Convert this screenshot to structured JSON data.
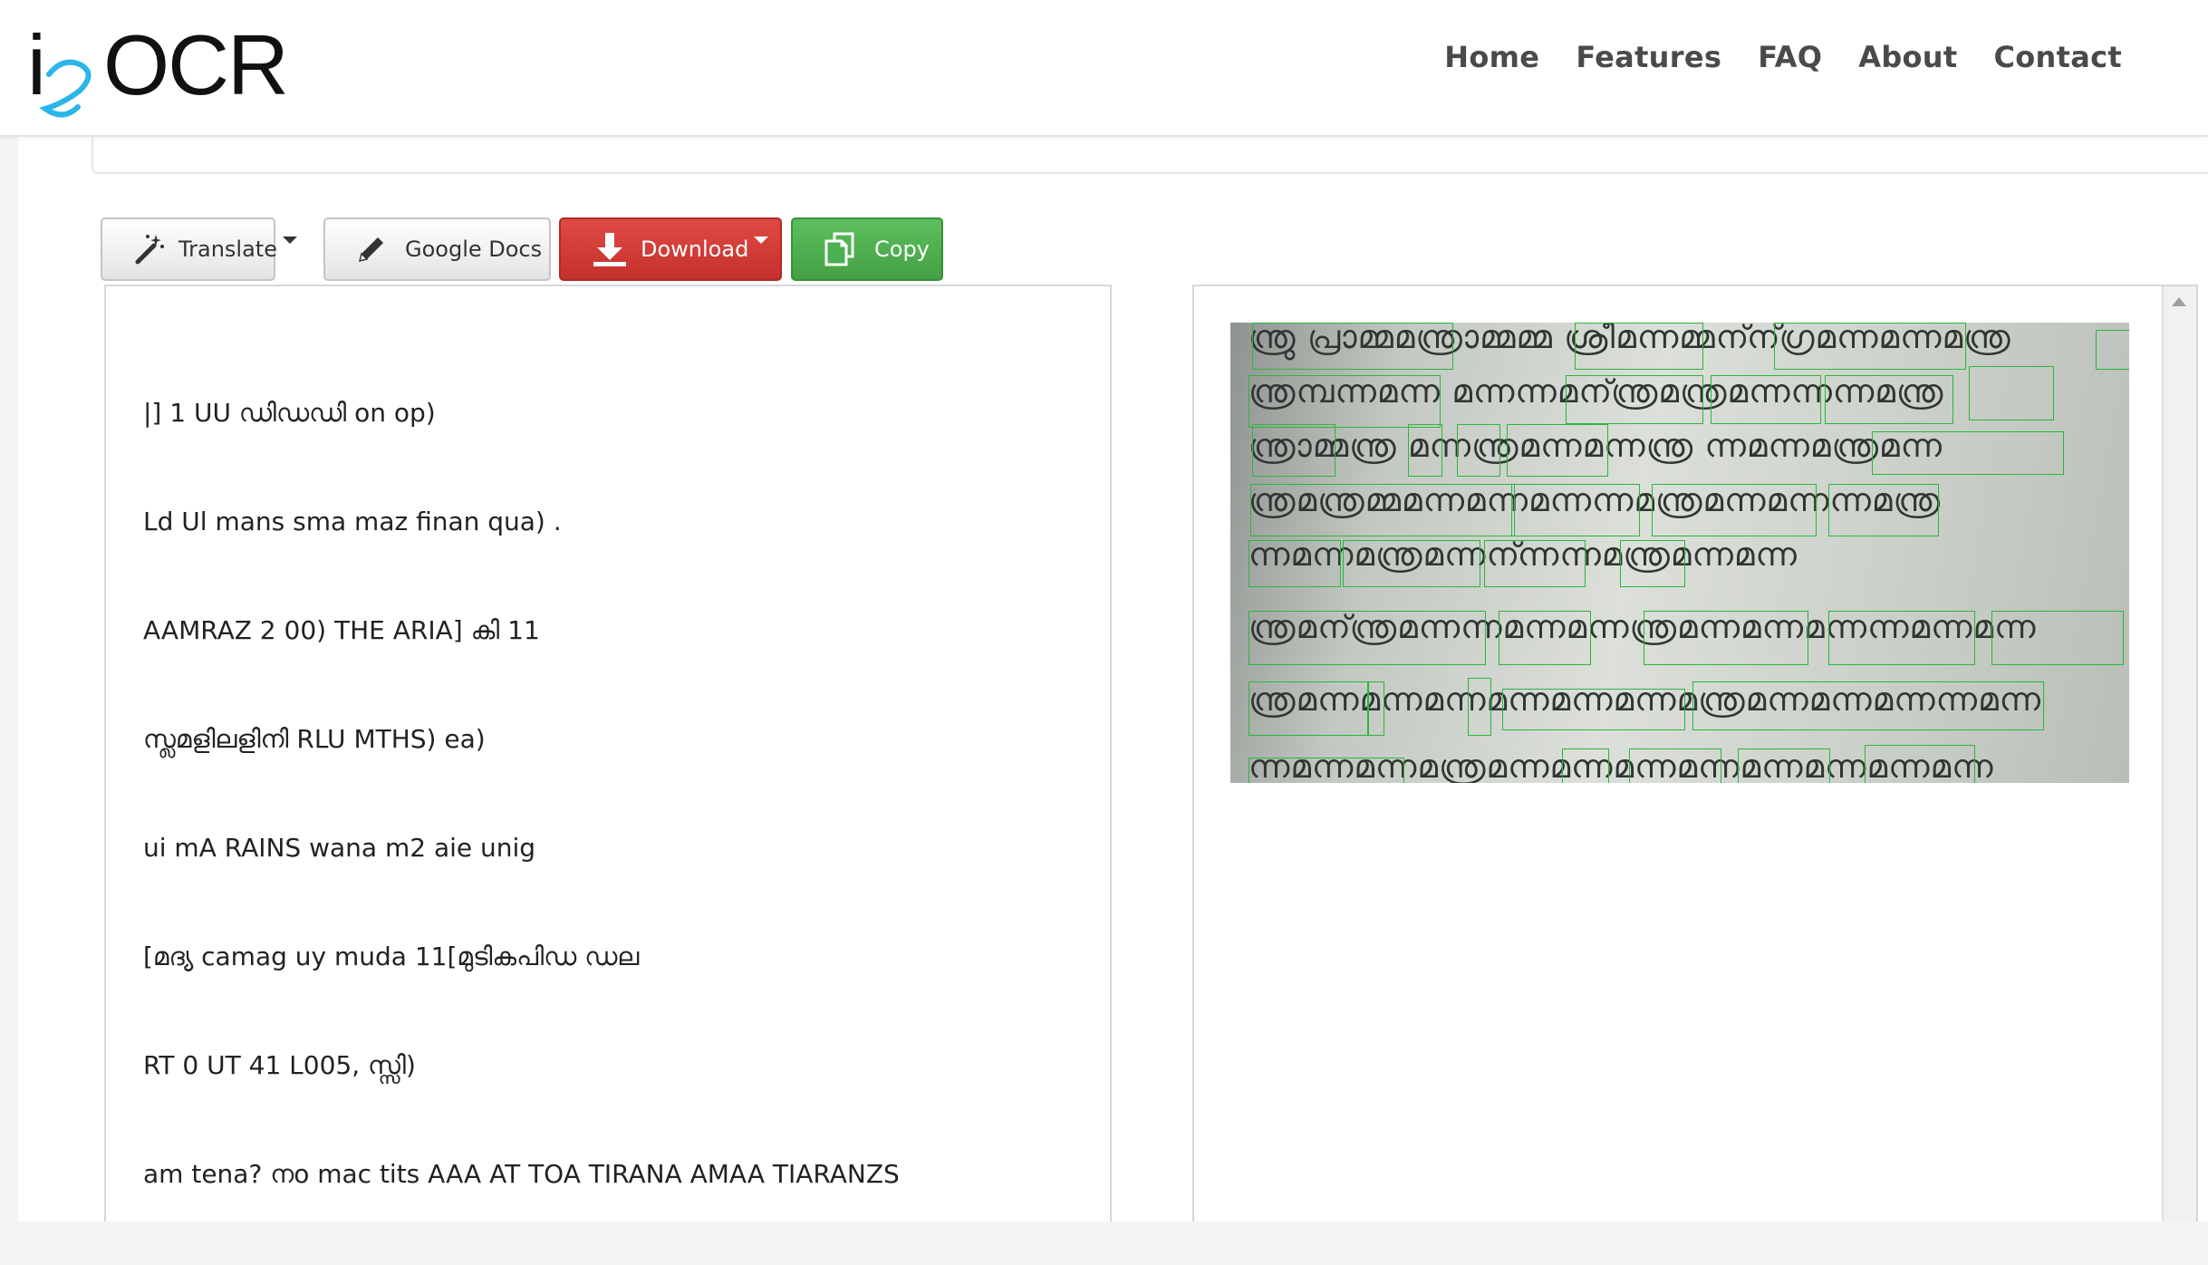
{
  "brand": {
    "logo_i": "i",
    "logo_ocr": "OCR"
  },
  "nav": {
    "home": "Home",
    "features": "Features",
    "faq": "FAQ",
    "about": "About",
    "contact": "Contact"
  },
  "toolbar": {
    "translate": "Translate",
    "google_docs": "Google Docs",
    "download": "Download",
    "copy": "Copy"
  },
  "colors": {
    "download": "#d23a35",
    "copy": "#4caf50",
    "box": "#28b83a"
  },
  "icons": {
    "translate": "magic-wand-icon",
    "google_docs": "pencil-icon",
    "download": "download-arrow-icon",
    "copy": "copy-icon",
    "scroll_up": "scroll-up-icon"
  },
  "ocr_text": [
    "|] 1 UU ഡിഡഡി on op)",
    "Ld Ul mans sma maz finan qua) .",
    "AAMRAZ 2 00) THE ARIA] കി 11",
    "സ്ലമളിലളിനി RLU MTHS) ea)",
    "ui mA RAINS wana m2 aie unig",
    "[മദ്യ camag uy muda 11[മുടികപിഡ ഡല",
    "RT 0 UT 41 L005, സ്സി)",
    "am tena? നo mac tits AAA AT TOA TIRANA AMAA TIARANZS"
  ]
}
